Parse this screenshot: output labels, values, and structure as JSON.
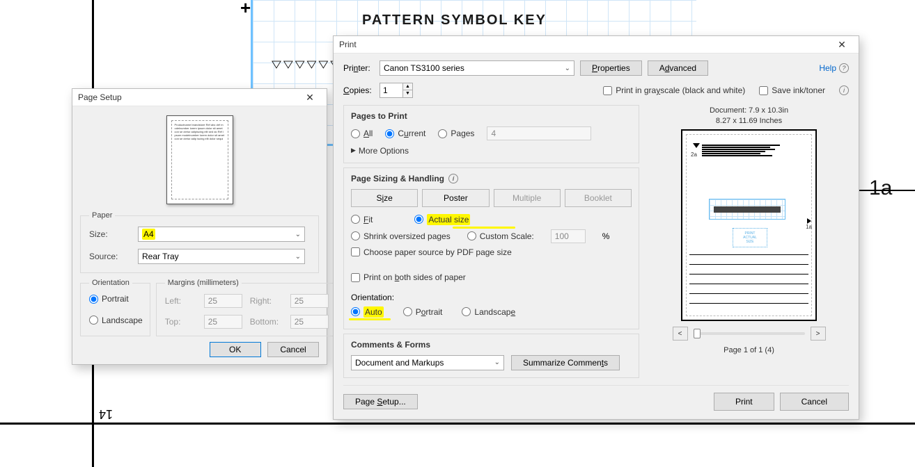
{
  "bg": {
    "title": "PATTERN SYMBOL KEY",
    "label_1a": "1a",
    "label_14": "14"
  },
  "page_setup": {
    "title": "Page Setup",
    "paper_legend": "Paper",
    "size_label": "Size:",
    "size_value": "A4",
    "source_label": "Source:",
    "source_value": "Rear Tray",
    "orientation_legend": "Orientation",
    "opt_portrait": "Portrait",
    "opt_landscape": "Landscape",
    "margins_legend": "Margins (millimeters)",
    "left_label": "Left:",
    "right_label": "Right:",
    "top_label": "Top:",
    "bottom_label": "Bottom:",
    "margin_value": "25",
    "ok": "OK",
    "cancel": "Cancel"
  },
  "print": {
    "title": "Print",
    "printer_label": "Printer:",
    "printer_value": "Canon TS3100 series",
    "properties": "Properties",
    "advanced": "Advanced",
    "help": "Help",
    "copies_label": "Copies:",
    "copies_value": "1",
    "grayscale": "Print in grayscale (black and white)",
    "save_ink": "Save ink/toner",
    "pages_title": "Pages to Print",
    "opt_all": "All",
    "opt_current": "Current",
    "opt_pages": "Pages",
    "pages_value": "4",
    "more_options": "More Options",
    "sizing_title": "Page Sizing & Handling",
    "tab_size": "Size",
    "tab_poster": "Poster",
    "tab_multiple": "Multiple",
    "tab_booklet": "Booklet",
    "opt_fit": "Fit",
    "opt_actual": "Actual size",
    "opt_shrink": "Shrink oversized pages",
    "opt_custom": "Custom Scale:",
    "scale_value": "100",
    "percent": "%",
    "choose_source": "Choose paper source by PDF page size",
    "both_sides": "Print on both sides of paper",
    "orientation_label": "Orientation:",
    "ori_auto": "Auto",
    "ori_portrait": "Portrait",
    "ori_landscape": "Landscape",
    "comments_title": "Comments & Forms",
    "comments_value": "Document and Markups",
    "summarize": "Summarize Comments",
    "doc_info": "Document: 7.9 x 10.3in",
    "paper_dims": "8.27 x 11.69 Inches",
    "preview_2a": "2a",
    "preview_1a": "1a",
    "page_of": "Page 1 of 1 (4)",
    "page_setup_btn": "Page Setup...",
    "print_btn": "Print",
    "cancel_btn": "Cancel"
  }
}
